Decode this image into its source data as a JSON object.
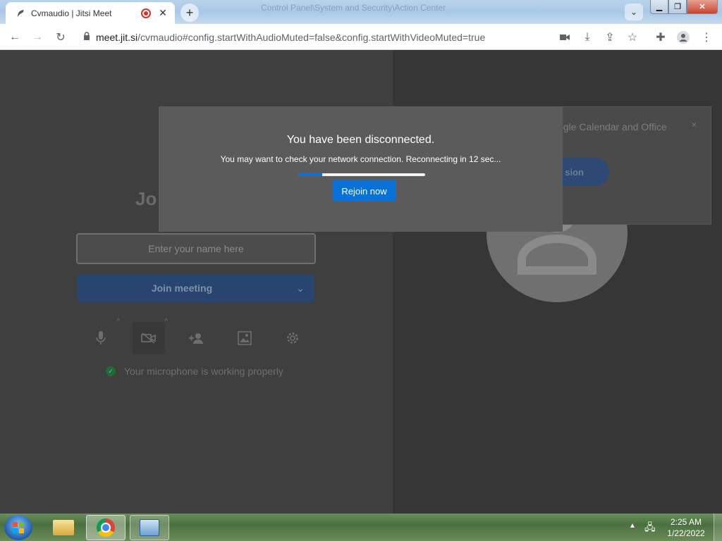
{
  "browser": {
    "tab_title": "Cvmaudio | Jitsi Meet",
    "background_window_title": "Control Panel\\System and Security\\Action Center",
    "url_host": "meet.jit.si",
    "url_path": "/cvmaudio#config.startWithAudioMuted=false&config.startWithVideoMuted=true"
  },
  "prejoin": {
    "title": "Jo",
    "name_placeholder": "Enter your name here",
    "join_label": "Join meeting",
    "mic_status": "Your microphone is working properly"
  },
  "notification": {
    "text": "ogle Calendar and Office",
    "button_label": "sion",
    "close": "×"
  },
  "dialog": {
    "title": "You have been disconnected.",
    "message": "You may want to check your network connection. Reconnecting in 12 sec...",
    "progress": 0.19,
    "rejoin_label": "Rejoin now"
  },
  "taskbar": {
    "time": "2:25 AM",
    "date": "1/22/2022"
  },
  "icons": {
    "favicon": "feather-icon",
    "recording": "recording-dot-icon",
    "lock": "lock-icon",
    "mic": "microphone-icon",
    "camera": "camera-off-icon",
    "invite": "add-person-icon",
    "background": "image-icon",
    "settings": "gear-icon",
    "avatar": "user-silhouette-icon"
  },
  "colors": {
    "rejoin_blue": "#0a72d7",
    "progress_blue": "#0f6fd6",
    "join_button": "#28456f",
    "dialog_bg": "#5b5b5b"
  }
}
